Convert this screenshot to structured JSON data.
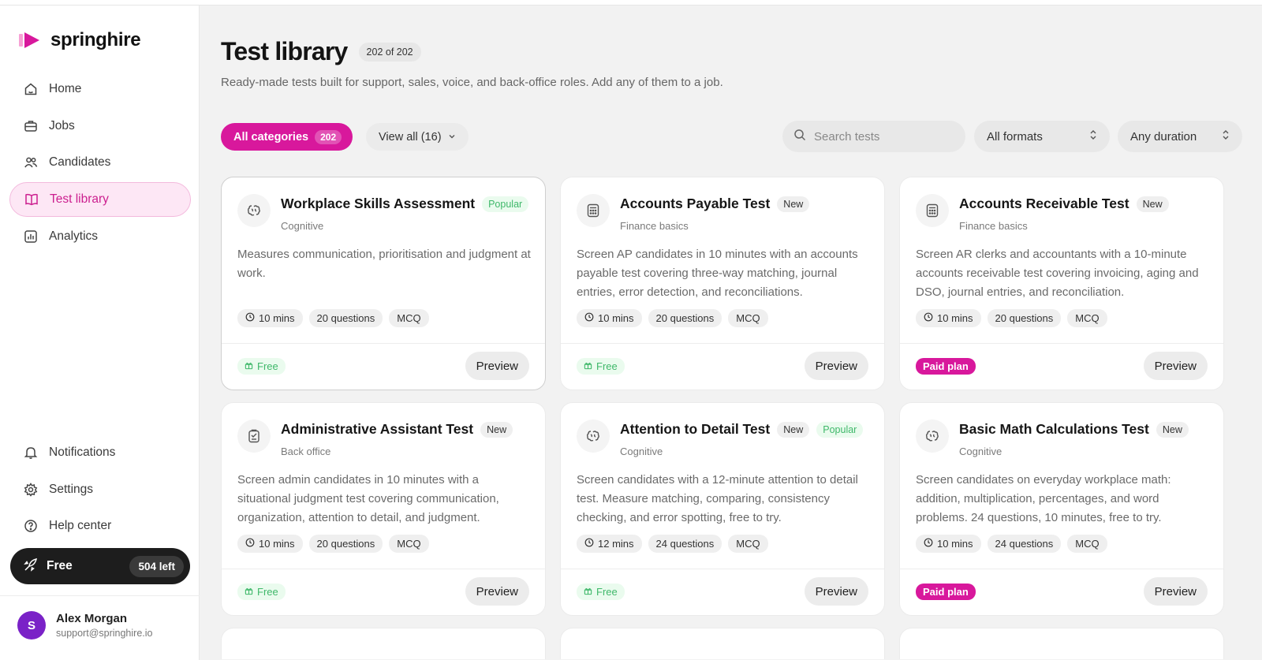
{
  "brand": {
    "name": "springhire",
    "accent": "#d8189c"
  },
  "nav": {
    "items": [
      {
        "label": "Home",
        "icon": "home-icon"
      },
      {
        "label": "Jobs",
        "icon": "briefcase-icon"
      },
      {
        "label": "Candidates",
        "icon": "users-icon"
      },
      {
        "label": "Test library",
        "icon": "book-icon",
        "active": true
      },
      {
        "label": "Analytics",
        "icon": "chart-icon"
      }
    ],
    "bottom": [
      {
        "label": "Notifications",
        "icon": "bell-icon"
      },
      {
        "label": "Settings",
        "icon": "gear-icon"
      },
      {
        "label": "Help center",
        "icon": "help-icon"
      }
    ]
  },
  "plan": {
    "label": "Free",
    "remaining": "504 left"
  },
  "user": {
    "initial": "S",
    "name": "Alex Morgan",
    "email": "support@springhire.io"
  },
  "page": {
    "title": "Test library",
    "count": "202 of 202",
    "subtitle": "Ready-made tests built for support, sales, voice, and back-office roles. Add any of them to a job."
  },
  "filters": {
    "all_label": "All categories",
    "all_count": "202",
    "view_all": "View all (16)",
    "search_placeholder": "Search tests",
    "format": "All formats",
    "duration": "Any duration"
  },
  "cards": [
    {
      "title": "Workplace Skills Assessment",
      "tags": [
        "Popular"
      ],
      "category": "Cognitive",
      "description": "Measures communication, prioritisation and judgment at work.",
      "duration": "10 mins",
      "questions": "20 questions",
      "format": "MCQ",
      "price": "Free",
      "cta": "Preview",
      "icon": "brain-icon"
    },
    {
      "title": "Accounts Payable Test",
      "tags": [
        "New"
      ],
      "category": "Finance basics",
      "description": "Screen AP candidates in 10 minutes with an accounts payable test covering three-way matching, journal entries, error detection, and reconciliations.",
      "duration": "10 mins",
      "questions": "20 questions",
      "format": "MCQ",
      "price": "Free",
      "cta": "Preview",
      "icon": "calculator-icon"
    },
    {
      "title": "Accounts Receivable Test",
      "tags": [
        "New"
      ],
      "category": "Finance basics",
      "description": "Screen AR clerks and accountants with a 10-minute accounts receivable test covering invoicing, aging and DSO, journal entries, and reconciliation.",
      "duration": "10 mins",
      "questions": "20 questions",
      "format": "MCQ",
      "price": "Paid plan",
      "cta": "Preview",
      "icon": "calculator-icon"
    },
    {
      "title": "Administrative Assistant Test",
      "tags": [
        "New"
      ],
      "category": "Back office",
      "description": "Screen admin candidates in 10 minutes with a situational judgment test covering communication, organization, attention to detail, and judgment.",
      "duration": "10 mins",
      "questions": "20 questions",
      "format": "MCQ",
      "price": "Free",
      "cta": "Preview",
      "icon": "clipboard-icon"
    },
    {
      "title": "Attention to Detail Test",
      "tags": [
        "New",
        "Popular"
      ],
      "category": "Cognitive",
      "description": "Screen candidates with a 12-minute attention to detail test. Measure matching, comparing, consistency checking, and error spotting, free to try.",
      "duration": "12 mins",
      "questions": "24 questions",
      "format": "MCQ",
      "price": "Free",
      "cta": "Preview",
      "icon": "brain-icon"
    },
    {
      "title": "Basic Math Calculations Test",
      "tags": [
        "New"
      ],
      "category": "Cognitive",
      "description": "Screen candidates on everyday workplace math: addition, multiplication, percentages, and word problems. 24 questions, 10 minutes, free to try.",
      "duration": "10 mins",
      "questions": "24 questions",
      "format": "MCQ",
      "price": "Paid plan",
      "cta": "Preview",
      "icon": "brain-icon"
    }
  ]
}
